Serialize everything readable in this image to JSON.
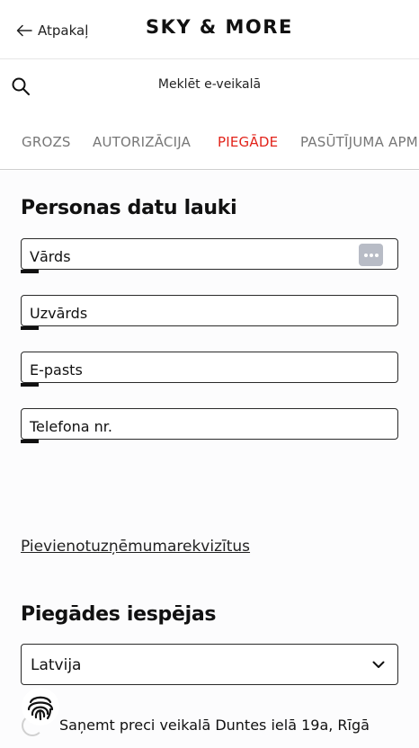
{
  "header": {
    "back_label": "Atpakaļ",
    "logo": "SKY & MORE"
  },
  "search": {
    "placeholder": "Meklēt e-veikalā"
  },
  "tabs": [
    {
      "label": "GROZS",
      "active": false
    },
    {
      "label": "AUTORIZĀCIJA",
      "active": false
    },
    {
      "label": "PIEGĀDE",
      "active": true
    },
    {
      "label": "PASŪTĪJUMA APM",
      "active": false
    }
  ],
  "personal": {
    "title": "Personas datu lauki",
    "fields": [
      {
        "label": "Vārds"
      },
      {
        "label": "Uzvārds"
      },
      {
        "label": "E-pasts"
      },
      {
        "label": "Telefona nr."
      }
    ]
  },
  "company_link": "Pievienotuzņēmumarekvizītus",
  "delivery": {
    "title": "Piegādes iespējas",
    "country": "Latvija",
    "option_label": "Saņemt preci veikalā Duntes ielā 19a, Rīgā"
  },
  "colors": {
    "accent": "#e2231a",
    "tab_inactive": "#777777"
  }
}
